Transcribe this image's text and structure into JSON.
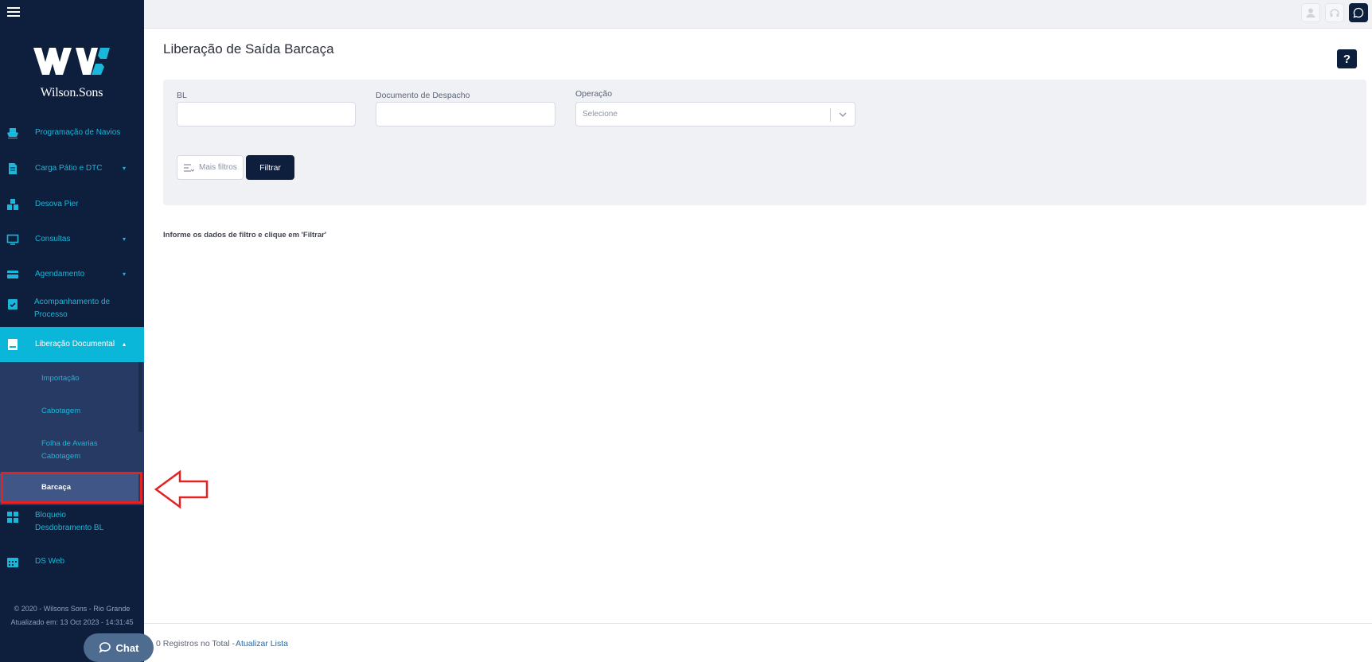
{
  "brand": {
    "name": "Wilson.Sons"
  },
  "sidebar": {
    "items": [
      {
        "label": "Programação de Navios",
        "icon": "ship-icon",
        "caret": ""
      },
      {
        "label": "Carga Pátio e DTC",
        "icon": "document-icon",
        "caret": "▾"
      },
      {
        "label": "Desova Pier",
        "icon": "boxes-icon",
        "caret": ""
      },
      {
        "label": "Consultas",
        "icon": "monitor-icon",
        "caret": "▾"
      },
      {
        "label": "Agendamento",
        "icon": "card-icon",
        "caret": "▾"
      },
      {
        "label": "Acompanhamento de Processo",
        "icon": "clipboard-check-icon",
        "caret": ""
      },
      {
        "label": "Liberação Documental",
        "icon": "book-icon",
        "caret": "▴"
      },
      {
        "label": "Bloqueio Desdobramento BL",
        "icon": "grid-icon",
        "caret": ""
      },
      {
        "label": "DS Web",
        "icon": "calendar-icon",
        "caret": ""
      }
    ],
    "submenu": [
      {
        "label": "Importação"
      },
      {
        "label": "Cabotagem"
      },
      {
        "label": "Folha de Avarias Cabotagem"
      },
      {
        "label": "Barcaça"
      }
    ],
    "footer_copyright": "© 2020 - Wilsons Sons - Rio Grande",
    "footer_updated": "Atualizado em: 13 Oct 2023 - 14:31:45"
  },
  "chat": {
    "label": "Chat"
  },
  "page": {
    "title": "Liberação de Saída Barcaça",
    "help_label": "?"
  },
  "filters": {
    "bl_label": "BL",
    "bl_value": "",
    "doc_label": "Documento de Despacho",
    "doc_value": "",
    "operation_label": "Operação",
    "operation_placeholder": "Selecione",
    "more_filters_label": "Mais filtros",
    "filter_button_label": "Filtrar"
  },
  "info_text": "Informe os dados de filtro e clique em 'Filtrar'",
  "bottom": {
    "records": "0 Registros no Total -",
    "refresh": "Atualizar Lista"
  },
  "colors": {
    "sidebar_bg": "#0d1f3c",
    "accent": "#0ab7d8",
    "submenu_bg": "#273a63",
    "highlight": "#e32222"
  }
}
